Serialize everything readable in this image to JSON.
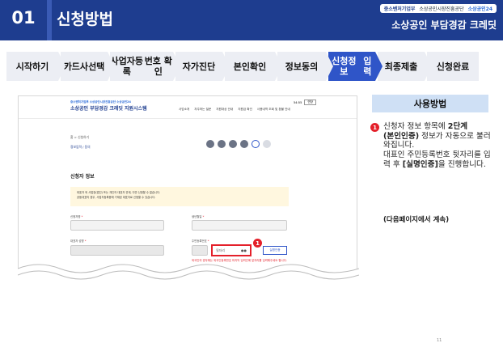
{
  "header": {
    "section_number": "01",
    "section_title": "신청방법",
    "brand_ministry": "중소벤처기업부",
    "brand_agency": "소상공인시장진흥공단",
    "brand_service": "소상공인24",
    "product_title": "소상공인 부담경감 크레딧"
  },
  "steps": [
    {
      "label": "시작하기",
      "active": false
    },
    {
      "label": "카드사\n선택",
      "active": false
    },
    {
      "label": "사업자등록\n번호 확인",
      "active": false
    },
    {
      "label": "자가진단",
      "active": false
    },
    {
      "label": "본인확인",
      "active": false
    },
    {
      "label": "정보동의",
      "active": false
    },
    {
      "label": "신청정보\n입력",
      "active": true
    },
    {
      "label": "최종제출",
      "active": false
    },
    {
      "label": "신청완료",
      "active": false
    }
  ],
  "screenshot": {
    "site_logo_small": "중소벤처기업부 소상공인시장진흥공단 소상공인24",
    "site_logo_title": "소상공인 부담경감 크레딧 지원시스템",
    "nav": [
      "사업소개",
      "자주하는 질문",
      "지원대상 안내",
      "지원금 확인",
      "사용내역 조회 및 환불 안내"
    ],
    "login_time": "54:55",
    "login_button": "연장",
    "breadcrumb": "홈 > 신청하기",
    "page_title": "정보입력 / 동의",
    "section_title": "신청자 정보",
    "notice_lines": [
      "대표자 외 사업장(법인) 또는 개인의 대표자 관계, 다만 신청할 수 없습니다.",
      "공동대표의 경우, 사업자등록증에 기재된 대표자로 신청할 수 있습니다."
    ],
    "labels": {
      "applicant_name": "신청자명",
      "birth_date": "생년월일",
      "rep_name": "대표자 성명",
      "rep_rrn": "주민등록번호"
    },
    "rrn_placeholder": "뒷자리",
    "verify_button": "실명인증",
    "error_message": "외국인의 경우에는 외국인등록번호 마지막 입력칸에 앞자리를 입력해주세요 합니다."
  },
  "usage": {
    "title": "사용방법",
    "badge": "1",
    "text_lines": [
      "신청자 정보 항목에 ",
      "2단계",
      "(본인인증)",
      " 정보가 자동으로 불러와집니다.",
      "대표인 주민등록번호 뒷자리를 입력 후 ",
      "[실명인증]",
      "을 진행합니다."
    ],
    "continue_note": "(다음페이지에서 계속)"
  },
  "page_number": "11",
  "colors": {
    "navy": "#1e3d8f",
    "active_step": "#2f55c8",
    "highlight": "#e4202a",
    "usage_box": "#cfe0f5"
  }
}
